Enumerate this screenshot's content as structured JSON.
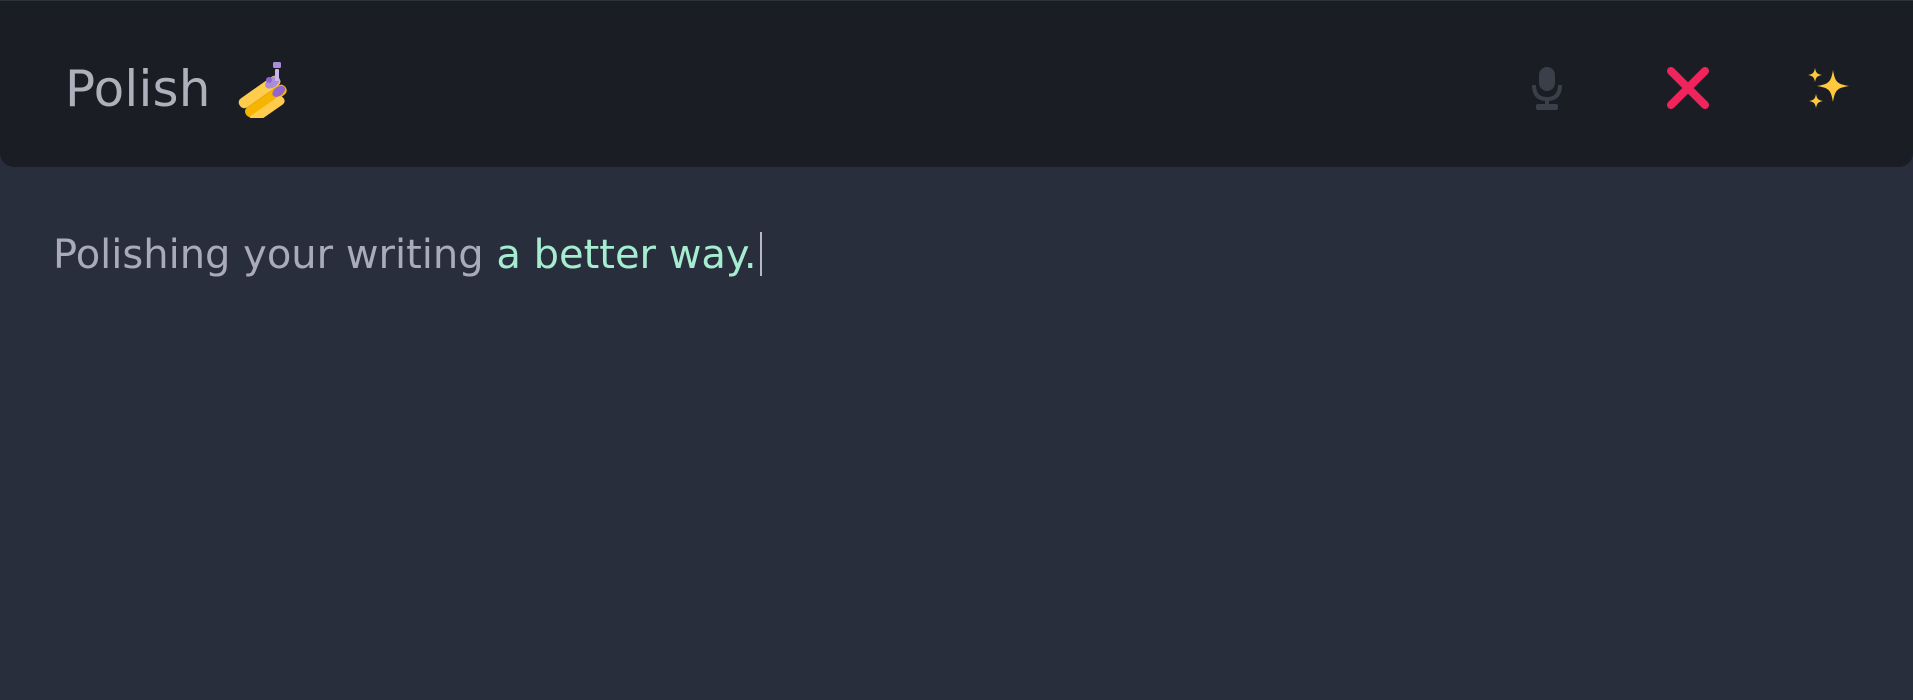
{
  "header": {
    "title": "Polish",
    "logo_icon": "nail-polish-icon",
    "buttons": {
      "mic_icon": "microphone-icon",
      "close_icon": "close-icon",
      "polish_icon": "sparkles-icon"
    }
  },
  "editor": {
    "text_plain": "Polishing your writing ",
    "text_highlighted": "a better way."
  },
  "colors": {
    "background": "#282e3b",
    "header_background": "#1a1d24",
    "title_text": "#aeb0bc",
    "body_text": "#a9acb8",
    "highlight_text": "#a6ecd0",
    "close_icon": "#f0245d",
    "sparkles": "#ffc83d",
    "mic_icon_muted": "#3a3f4a"
  }
}
